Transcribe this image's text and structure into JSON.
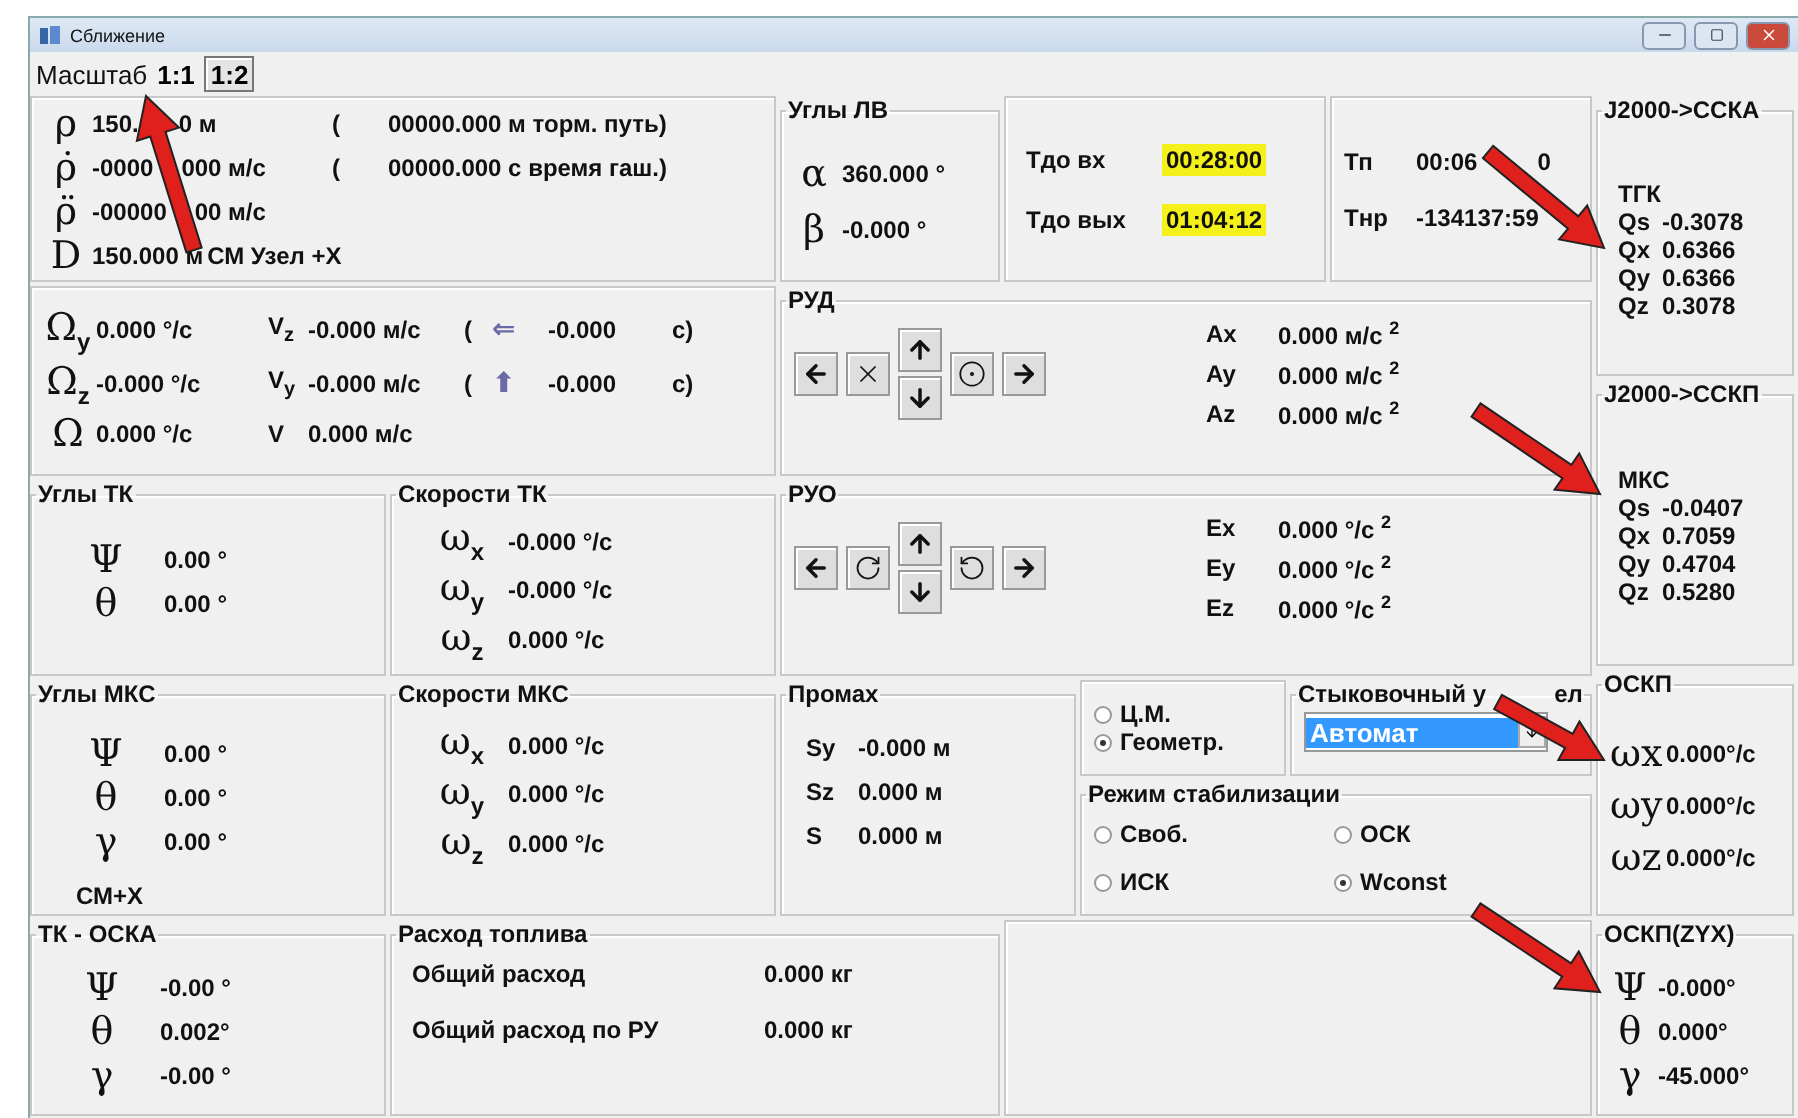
{
  "window": {
    "title": "Сближение"
  },
  "scale": {
    "label": "Масштаб",
    "options": [
      {
        "label": "1:1",
        "selected": true
      },
      {
        "label": "1:2",
        "selected": false
      }
    ]
  },
  "range": {
    "rows": [
      {
        "symbol": "ρ",
        "value": [
          "150.",
          "0 м"
        ],
        "paren": "(",
        "note": "00000.000 м торм. путь)"
      },
      {
        "symbol": "ρ̇",
        "value": [
          "-0000",
          "000 м/с"
        ],
        "paren": "(",
        "note": "00000.000 с время гаш.)"
      },
      {
        "symbol": "ρ̈",
        "value": [
          "-00000",
          "00 м/с"
        ]
      },
      {
        "symbol": "D",
        "value": "150.000 м",
        "note": "СМ Узел +X"
      }
    ]
  },
  "lv_angles": {
    "title": "Углы ЛВ",
    "rows": [
      {
        "symbol": "α",
        "value": "360.000 °"
      },
      {
        "symbol": "β",
        "value": "-0.000 °"
      }
    ]
  },
  "times": {
    "rows": [
      {
        "label": "Тдо вх",
        "value": "00:28:00",
        "highlight": true
      },
      {
        "label": "Тдо вых",
        "value": "01:04:12",
        "highlight": true
      }
    ]
  },
  "tp": {
    "rows": [
      {
        "label": "Тп",
        "value": [
          "00:06",
          "0"
        ]
      },
      {
        "label": "Тнр",
        "value": "-134137:59"
      }
    ]
  },
  "rates": {
    "rows": [
      {
        "symbol": "Ω$_{y}$",
        "value": "0.000 °/с",
        "vsym": "V$_{z}$",
        "vvalue": "-0.000 м/с",
        "open": "(",
        "arrow": "⇐",
        "time": "-0.000",
        "close": "с)"
      },
      {
        "symbol": "Ω$_{z}$",
        "value": "-0.000 °/с",
        "vsym": "V$_{y}$",
        "vvalue": "-0.000 м/с",
        "open": "(",
        "arrow": "⬆",
        "time": "-0.000",
        "close": "с)"
      },
      {
        "symbol": "Ω",
        "value": "0.000 °/с",
        "vsym": "V",
        "vvalue": "0.000 м/с"
      }
    ]
  },
  "rud": {
    "title": "РУД",
    "buttons": [
      {
        "kind": "left"
      },
      {
        "kind": "stop"
      },
      {
        "kind": "updown"
      },
      {
        "kind": "center"
      },
      {
        "kind": "right"
      }
    ],
    "rows": [
      {
        "label": "Ax",
        "value": "0.000 м/с $^{2}$"
      },
      {
        "label": "Ay",
        "value": "0.000 м/с $^{2}$"
      },
      {
        "label": "Az",
        "value": "0.000 м/с $^{2}$"
      }
    ]
  },
  "ruo": {
    "title": "РУО",
    "buttons": [
      {
        "kind": "left"
      },
      {
        "kind": "cw"
      },
      {
        "kind": "updown"
      },
      {
        "kind": "ccw"
      },
      {
        "kind": "right"
      }
    ],
    "rows": [
      {
        "label": "Ex",
        "value": "0.000 °/с $^{2}$"
      },
      {
        "label": "Ey",
        "value": "0.000 °/с $^{2}$"
      },
      {
        "label": "Ez",
        "value": "0.000 °/с $^{2}$"
      }
    ]
  },
  "ccka": {
    "title": "J2000->ССКА",
    "subtitle": "ТГК",
    "rows": [
      {
        "label": "Qs",
        "value": "-0.3078"
      },
      {
        "label": "Qx",
        "value": "0.6366"
      },
      {
        "label": "Qy",
        "value": "0.6366"
      },
      {
        "label": "Qz",
        "value": "0.3078"
      }
    ]
  },
  "cckp": {
    "title": "J2000->ССКП",
    "subtitle": "МКС",
    "rows": [
      {
        "label": "Qs",
        "value": "-0.0407"
      },
      {
        "label": "Qx",
        "value": "0.7059"
      },
      {
        "label": "Qy",
        "value": "0.4704"
      },
      {
        "label": "Qz",
        "value": "0.5280"
      }
    ]
  },
  "tk_angles": {
    "title": "Углы ТК",
    "rows": [
      {
        "symbol": "Ψ",
        "value": "0.00 °"
      },
      {
        "symbol": "θ",
        "value": "0.00 °"
      }
    ]
  },
  "tk_rates": {
    "title": "Скорости ТК",
    "rows": [
      {
        "symbol": "ω$_{x}$",
        "value": "-0.000 °/с"
      },
      {
        "symbol": "ω$_{y}$",
        "value": "-0.000 °/с"
      },
      {
        "symbol": "ω$_{z}$",
        "value": "0.000 °/с"
      }
    ]
  },
  "mks_angles": {
    "title": "Углы МКС",
    "rows": [
      {
        "symbol": "Ψ",
        "value": "0.00 °"
      },
      {
        "symbol": "θ",
        "value": "0.00 °"
      },
      {
        "symbol": "γ",
        "value": "0.00 °"
      }
    ],
    "note": "СМ+X"
  },
  "mks_rates": {
    "title": "Скорости МКС",
    "rows": [
      {
        "symbol": "ω$_{x}$",
        "value": "0.000 °/с"
      },
      {
        "symbol": "ω$_{y}$",
        "value": "0.000 °/с"
      },
      {
        "symbol": "ω$_{z}$",
        "value": "0.000 °/с"
      }
    ]
  },
  "miss": {
    "title": "Промах",
    "rows": [
      {
        "label": "Sy",
        "value": "-0.000 м"
      },
      {
        "label": "Sz",
        "value": "0.000 м"
      },
      {
        "label": "S",
        "value": "0.000 м"
      }
    ]
  },
  "center": {
    "options": [
      {
        "label": "Ц.М.",
        "selected": false
      },
      {
        "label": "Геометр.",
        "selected": true
      }
    ]
  },
  "dock": {
    "title": [
      "Стыковочный у",
      "ел"
    ],
    "value": "Автомат"
  },
  "stab": {
    "title": "Режим стабилизации",
    "options": [
      {
        "label": "Своб.",
        "selected": false
      },
      {
        "label": "ОСК",
        "selected": false
      },
      {
        "label": "ИСК",
        "selected": false
      },
      {
        "label": "Wconst",
        "selected": true
      }
    ]
  },
  "oskp": {
    "title": "ОСКП",
    "rows": [
      {
        "symbol": "ωx",
        "value": "0.000°/с"
      },
      {
        "symbol": "ωy",
        "value": "0.000°/с"
      },
      {
        "symbol": "ωz",
        "value": "0.000°/с"
      }
    ]
  },
  "tk_oska": {
    "title": "ТК - ОСКА",
    "rows": [
      {
        "symbol": "Ψ",
        "value": "-0.00 °"
      },
      {
        "symbol": "θ",
        "value": "0.002°"
      },
      {
        "symbol": "γ",
        "value": "-0.00 °"
      }
    ]
  },
  "fuel": {
    "title": "Расход топлива",
    "rows": [
      {
        "label": "Общий расход",
        "value": "0.000 кг"
      },
      {
        "label": "Общий расход по РУ",
        "value": "0.000 кг"
      }
    ]
  },
  "oskp_zyx": {
    "title": "ОСКП(ZYX)",
    "rows": [
      {
        "symbol": "Ψ",
        "value": "-0.000°"
      },
      {
        "symbol": "θ",
        "value": "0.000°"
      },
      {
        "symbol": "γ",
        "value": "-45.000°"
      }
    ]
  }
}
